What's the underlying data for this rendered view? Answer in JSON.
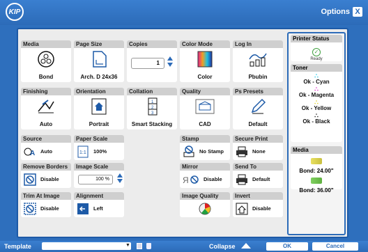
{
  "header": {
    "logo": "KIP",
    "options_label": "Options",
    "close_label": "X"
  },
  "tiles": {
    "media": {
      "label": "Media",
      "value": "Bond"
    },
    "page_size": {
      "label": "Page Size",
      "value": "Arch. D 24x36"
    },
    "copies": {
      "label": "Copies",
      "value": "1"
    },
    "color_mode": {
      "label": "Color Mode",
      "value": "Color"
    },
    "log_in": {
      "label": "Log In",
      "value": "Pbubin"
    },
    "finishing": {
      "label": "Finishing",
      "value": "Auto"
    },
    "orientation": {
      "label": "Orientation",
      "value": "Portrait"
    },
    "collation": {
      "label": "Collation",
      "value": "Smart Stacking"
    },
    "quality": {
      "label": "Quality",
      "value": "CAD"
    },
    "ps_presets": {
      "label": "Ps Presets",
      "value": "Default"
    },
    "source": {
      "label": "Source",
      "value": "Auto"
    },
    "paper_scale": {
      "label": "Paper Scale",
      "value": "100%"
    },
    "stamp": {
      "label": "Stamp",
      "value": "No Stamp"
    },
    "secure_print": {
      "label": "Secure Print",
      "value": "None"
    },
    "remove_borders": {
      "label": "Remove Borders",
      "value": "Disable"
    },
    "image_scale": {
      "label": "Image Scale",
      "value": "100 %"
    },
    "mirror": {
      "label": "Mirror",
      "value": "Disable"
    },
    "send_to": {
      "label": "Send To",
      "value": "Default"
    },
    "trim_at_image": {
      "label": "Trim At Image",
      "value": "Disable"
    },
    "alignment": {
      "label": "Alignment",
      "value": "Left"
    },
    "image_quality": {
      "label": "Image Quality"
    },
    "invert": {
      "label": "Invert",
      "value": "Disable"
    }
  },
  "status": {
    "printer_status": {
      "label": "Printer Status",
      "value": "Ready"
    },
    "toner": {
      "label": "Toner",
      "items": [
        {
          "text": "Ok - Cyan",
          "color": "#22c7e8"
        },
        {
          "text": "Ok - Magenta",
          "color": "#e020c8"
        },
        {
          "text": "Ok - Yellow",
          "color": "#f0e020"
        },
        {
          "text": "Ok - Black",
          "color": "#111111"
        }
      ]
    },
    "media": {
      "label": "Media",
      "items": [
        {
          "text": "Bond: 24.00\"",
          "color": "#e8e060"
        },
        {
          "text": "Bond: 36.00\"",
          "color": "#80d060"
        }
      ]
    }
  },
  "footer": {
    "template_label": "Template",
    "collapse_label": "Collapse",
    "ok_label": "OK",
    "cancel_label": "Cancel"
  },
  "colors": {
    "brand_blue": "#2c6bb8",
    "accent_blue": "#1d5aa7"
  }
}
